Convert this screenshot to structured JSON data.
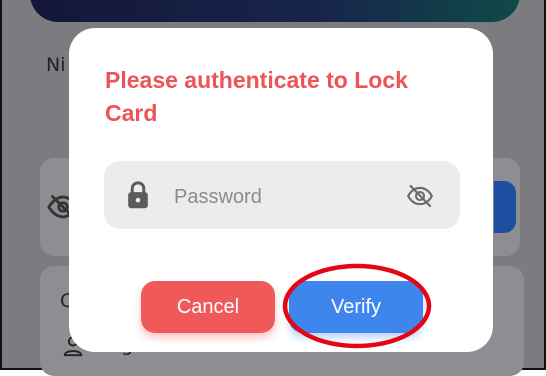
{
  "background": {
    "nickname_label_partial": "Ni",
    "card_label_partial": "C",
    "name_partial": "Ung Ho Yan"
  },
  "dialog": {
    "title": "Please authenticate to Lock Card",
    "password_placeholder": "Password",
    "password_value": "",
    "cancel_label": "Cancel",
    "verify_label": "Verify"
  },
  "colors": {
    "title": "#ec5457",
    "cancel": "#f0595a",
    "verify": "#3e86ed",
    "annotation": "#e30613"
  },
  "icons": {
    "lock": "lock-icon",
    "eye_off": "eye-off-icon",
    "person": "person-icon"
  }
}
